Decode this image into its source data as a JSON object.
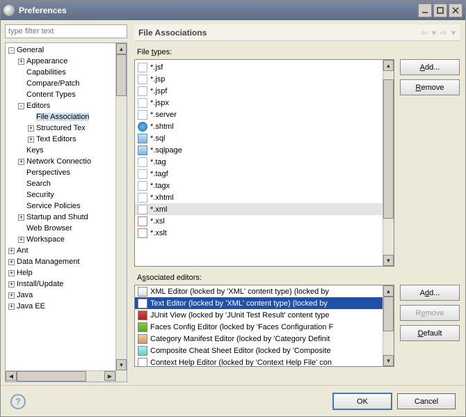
{
  "window": {
    "title": "Preferences"
  },
  "filter": {
    "placeholder": "type filter text"
  },
  "tree": [
    {
      "d": 0,
      "tw": "-",
      "label": "General"
    },
    {
      "d": 1,
      "tw": "+",
      "label": "Appearance"
    },
    {
      "d": 1,
      "tw": "",
      "label": "Capabilities"
    },
    {
      "d": 1,
      "tw": "",
      "label": "Compare/Patch"
    },
    {
      "d": 1,
      "tw": "",
      "label": "Content Types"
    },
    {
      "d": 1,
      "tw": "-",
      "label": "Editors"
    },
    {
      "d": 2,
      "tw": "",
      "label": "File Association",
      "sel": true
    },
    {
      "d": 2,
      "tw": "+",
      "label": "Structured Tex"
    },
    {
      "d": 2,
      "tw": "+",
      "label": "Text Editors"
    },
    {
      "d": 1,
      "tw": "",
      "label": "Keys"
    },
    {
      "d": 1,
      "tw": "+",
      "label": "Network Connectio"
    },
    {
      "d": 1,
      "tw": "",
      "label": "Perspectives"
    },
    {
      "d": 1,
      "tw": "",
      "label": "Search"
    },
    {
      "d": 1,
      "tw": "",
      "label": "Security"
    },
    {
      "d": 1,
      "tw": "",
      "label": "Service Policies"
    },
    {
      "d": 1,
      "tw": "+",
      "label": "Startup and Shutd"
    },
    {
      "d": 1,
      "tw": "",
      "label": "Web Browser"
    },
    {
      "d": 1,
      "tw": "+",
      "label": "Workspace"
    },
    {
      "d": 0,
      "tw": "+",
      "label": "Ant"
    },
    {
      "d": 0,
      "tw": "+",
      "label": "Data Management"
    },
    {
      "d": 0,
      "tw": "+",
      "label": "Help"
    },
    {
      "d": 0,
      "tw": "+",
      "label": "Install/Update"
    },
    {
      "d": 0,
      "tw": "+",
      "label": "Java"
    },
    {
      "d": 0,
      "tw": "+",
      "label": "Java EE"
    }
  ],
  "header": {
    "title": "File Associations"
  },
  "labels": {
    "fileTypes_pre": "File ",
    "fileTypes_u": "t",
    "fileTypes_post": "ypes:",
    "assoc_pre": "A",
    "assoc_u": "s",
    "assoc_post": "sociated editors:"
  },
  "fileTypes": [
    {
      "ic": "file",
      "t": "*.jsf"
    },
    {
      "ic": "file",
      "t": "*.jsp"
    },
    {
      "ic": "file",
      "t": "*.jspf"
    },
    {
      "ic": "file",
      "t": "*.jspx"
    },
    {
      "ic": "file",
      "t": "*.server"
    },
    {
      "ic": "web",
      "t": "*.shtml"
    },
    {
      "ic": "db",
      "t": "*.sql"
    },
    {
      "ic": "db",
      "t": "*.sqlpage"
    },
    {
      "ic": "file",
      "t": "*.tag"
    },
    {
      "ic": "file",
      "t": "*.tagf"
    },
    {
      "ic": "file",
      "t": "*.tagx"
    },
    {
      "ic": "file",
      "t": "*.xhtml"
    },
    {
      "ic": "file",
      "t": "*.xml",
      "sel": true
    },
    {
      "ic": "xsl",
      "t": "*.xsl"
    },
    {
      "ic": "xsl",
      "t": "*.xslt"
    }
  ],
  "buttons": {
    "add_u": "A",
    "add_rest": "dd...",
    "remove_u": "R",
    "remove_rest": "emove",
    "add2_pre": "A",
    "add2_u": "d",
    "add2_post": "d...",
    "remove2_pre": "R",
    "remove2_u": "e",
    "remove2_post": "move",
    "default_u": "D",
    "default_rest": "efault",
    "ok": "OK",
    "cancel": "Cancel"
  },
  "editors": [
    {
      "ic": "xml",
      "t": "XML Editor (locked by 'XML' content type) (locked by"
    },
    {
      "ic": "txt",
      "t": "Text Editor (locked by 'XML' content type) (locked by",
      "sel": true
    },
    {
      "ic": "ju",
      "t": "JUnit View (locked by 'JUnit Test Result' content type"
    },
    {
      "ic": "fc",
      "t": "Faces Config Editor (locked by 'Faces Configuration F"
    },
    {
      "ic": "cm",
      "t": "Category Manifest Editor (locked by 'Category Definit"
    },
    {
      "ic": "cs",
      "t": "Composite Cheat Sheet Editor (locked by 'Composite"
    },
    {
      "ic": "ch",
      "t": "Context Help Editor (locked by 'Context Help File' con"
    }
  ]
}
